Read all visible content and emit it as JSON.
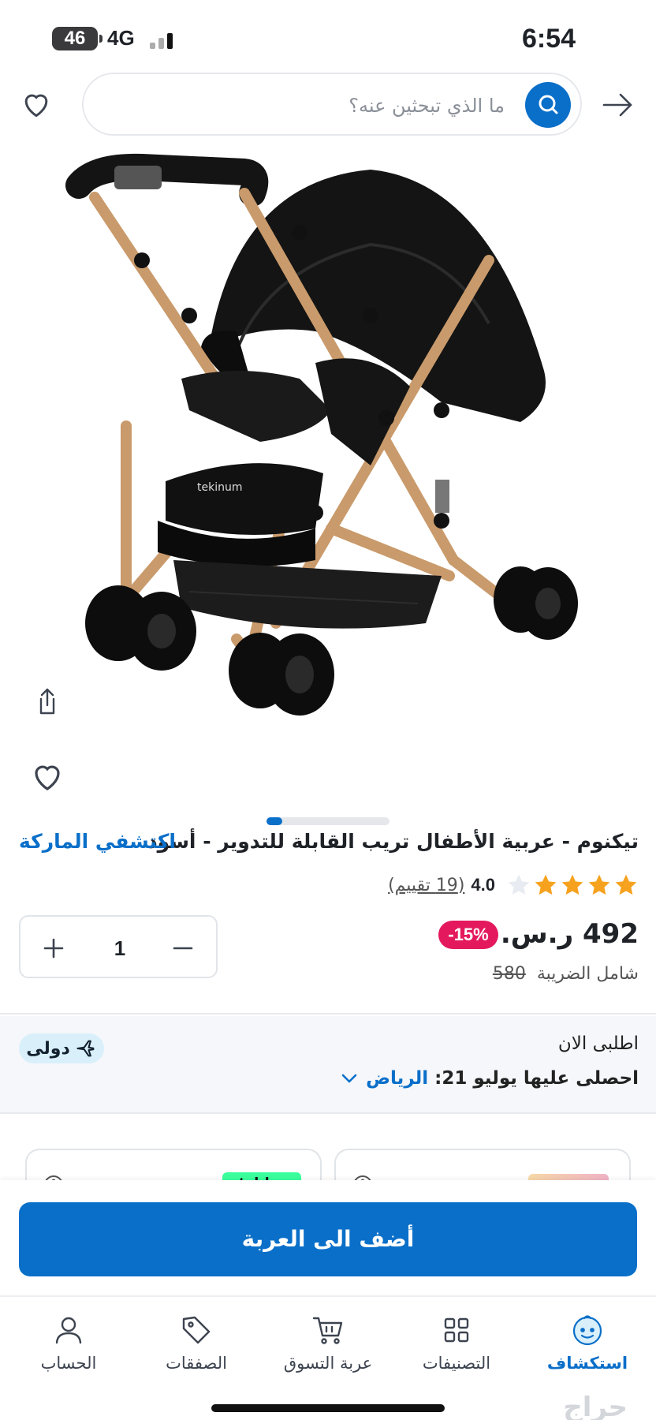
{
  "status_bar": {
    "battery": "46",
    "network": "4G",
    "time": "6:54"
  },
  "search": {
    "placeholder": "ما الذي تبحثين عنه؟"
  },
  "product": {
    "title": "تيكنوم - عربية الأطفال تريب القابلة للتدوير - أسود",
    "brand_link": "اكتشفي الماركة",
    "rating_value": "4.0",
    "rating_count": "(19 تقييم)",
    "rating_stars": 4,
    "price": "492 ر.س.",
    "discount": "-15%",
    "old_price": "580",
    "tax_note": "شامل الضريبة",
    "quantity": "1",
    "image_count": 8,
    "image_index": 1,
    "image_brand_mark": "tekinum"
  },
  "delivery": {
    "order_now": "اطلبى الان",
    "get_it": "احصلى عليها يوليو 21:",
    "city": "الرياض",
    "badge": "دولى"
  },
  "payments": {
    "tabby_label": "tabby"
  },
  "cart": {
    "add_to_cart": "أضف الى العربة"
  },
  "nav": {
    "items": [
      {
        "label": "استكشاف",
        "icon": "explore-face-icon",
        "active": true
      },
      {
        "label": "التصنيفات",
        "icon": "grid-icon",
        "active": false
      },
      {
        "label": "عربة التسوق",
        "icon": "cart-icon",
        "active": false
      },
      {
        "label": "الصفقات",
        "icon": "tag-icon",
        "active": false
      },
      {
        "label": "الحساب",
        "icon": "user-icon",
        "active": false
      }
    ]
  },
  "watermark": "حراج",
  "colors": {
    "brand_blue": "#0a6fc9",
    "discount_pink": "#e4195d",
    "star_orange": "#f6a21e"
  }
}
